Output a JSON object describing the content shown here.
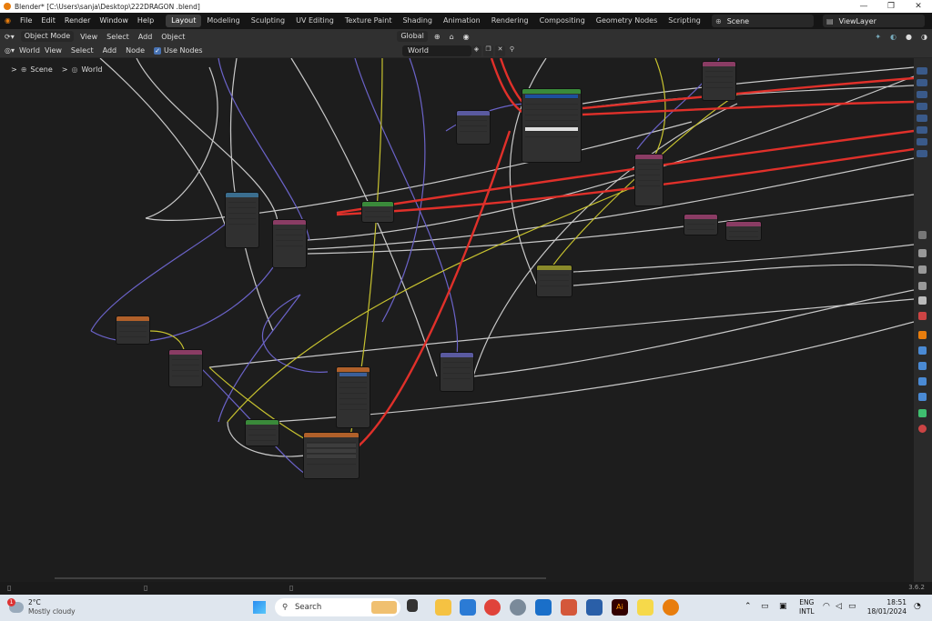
{
  "window": {
    "title": "Blender* [C:\\Users\\sanja\\Desktop\\222DRAGON .blend]",
    "controls": [
      "—",
      "❐",
      "✕"
    ]
  },
  "menubar": {
    "menus": [
      "File",
      "Edit",
      "Render",
      "Window",
      "Help"
    ],
    "workspaces": [
      "Layout",
      "Modeling",
      "Sculpting",
      "UV Editing",
      "Texture Paint",
      "Shading",
      "Animation",
      "Rendering",
      "Compositing",
      "Geometry Nodes",
      "Scripting"
    ],
    "active_workspace": "Layout",
    "add_workspace": "+",
    "scene": "Scene",
    "view_layer": "ViewLayer"
  },
  "editor_header": {
    "mode": "Object Mode",
    "items": [
      "View",
      "Select",
      "Add",
      "Object"
    ],
    "transform_orientation": "Global"
  },
  "node_header": {
    "type": "World",
    "items": [
      "View",
      "Select",
      "Add",
      "Node"
    ],
    "use_nodes_label": "Use Nodes",
    "use_nodes": true,
    "datablock": "World"
  },
  "breadcrumb": {
    "scene": "Scene",
    "world": "World",
    "separator": ">"
  },
  "status": {
    "version": "3.6.2"
  },
  "taskbar": {
    "weather_temp": "2°C",
    "weather_desc": "Mostly cloudy",
    "weather_badge": "1",
    "search_placeholder": "Search",
    "lang1": "ENG",
    "lang2": "INTL",
    "time": "18:51",
    "date": "18/01/2024"
  },
  "colors": {
    "accent": "#4772b3",
    "wire_white": "#c8c8c8",
    "wire_purple": "#6b63c9",
    "wire_yellow": "#c7c22f",
    "wire_red": "#e0302a"
  }
}
